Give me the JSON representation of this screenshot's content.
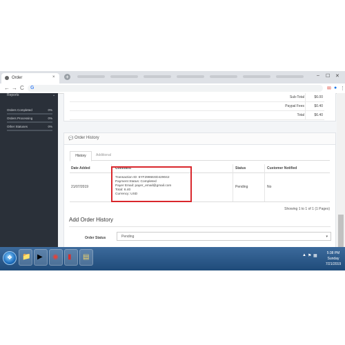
{
  "browser": {
    "tab_title": "Order",
    "tab_close": "×",
    "new_tab": "+",
    "address": "G",
    "window_controls": [
      "–",
      "☐",
      "✕"
    ],
    "nav": {
      "back": "←",
      "forward": "→",
      "reload": "C"
    }
  },
  "sidebar": {
    "heading": "Reports",
    "stats": [
      {
        "label": "Orders Completed",
        "percent": "0%"
      },
      {
        "label": "Orders Processing",
        "percent": "0%"
      },
      {
        "label": "Other Statuses",
        "percent": "0%"
      }
    ]
  },
  "totals": [
    {
      "label": "Sub-Total",
      "value": "$6.00"
    },
    {
      "label": "Paypal Fees",
      "value": "$0.40"
    },
    {
      "label": "Total",
      "value": "$6.40"
    }
  ],
  "order_history": {
    "title": "Order History",
    "tabs": [
      "History",
      "Additional"
    ],
    "columns": [
      "Date Added",
      "Comment",
      "Status",
      "Customer Notified"
    ],
    "rows": [
      {
        "date": "21/07/2019",
        "comment_lines": [
          "Transaction ID: 6YF29966XD429042",
          "Payment Status: Completed",
          "Payer Email: payer_email@gmail.com",
          "Total: 6.40",
          "Currency: USD"
        ],
        "status": "Pending",
        "notified": "No"
      }
    ],
    "showing": "Showing 1 to 1 of 1 (1 Pages)"
  },
  "add_history": {
    "title": "Add Order History",
    "order_status_label": "Order Status",
    "order_status_value": "Pending",
    "caret": "▾"
  },
  "taskbar": {
    "clock_time": "5:38 PM",
    "clock_day": "Sunday",
    "clock_date": "7/21/2019"
  }
}
